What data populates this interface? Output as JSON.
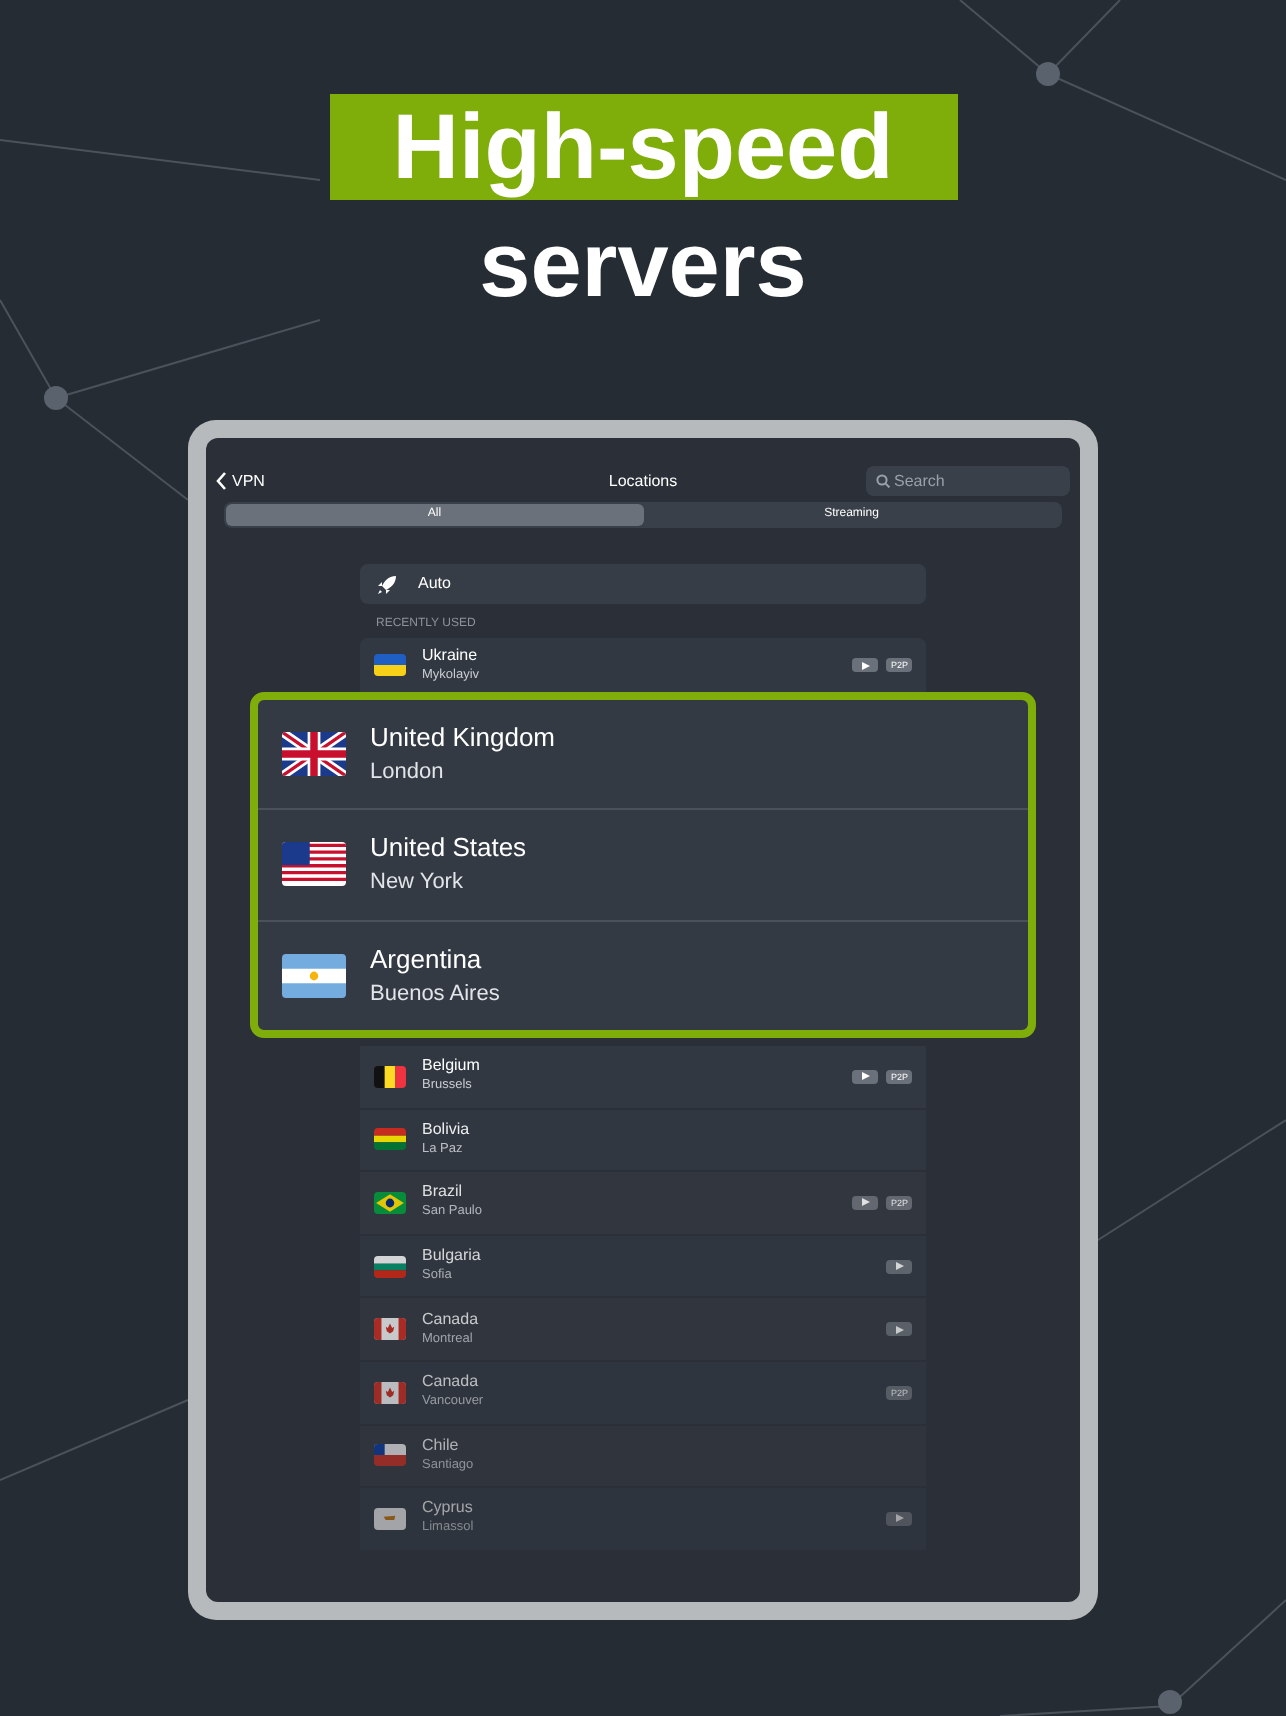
{
  "headline": {
    "highlight": "High-speed",
    "rest": "servers"
  },
  "nav": {
    "back": "VPN",
    "title": "Locations",
    "search": {
      "placeholder": "Search"
    }
  },
  "tabs": [
    {
      "label": "All",
      "selected": true
    },
    {
      "label": "Streaming",
      "selected": false
    }
  ],
  "auto": {
    "label": "Auto"
  },
  "recently_used": {
    "heading": "RECENTLY USED",
    "rows": [
      {
        "country": "Ukraine",
        "city": "Mykolayiv",
        "streaming": true,
        "badges": [
          "P2P"
        ]
      }
    ]
  },
  "featured": [
    {
      "country": "United Kingdom",
      "city": "London"
    },
    {
      "country": "United States",
      "city": "New York"
    },
    {
      "country": "Argentina",
      "city": "Buenos Aires"
    }
  ],
  "locations": [
    {
      "country": "Belgium",
      "city": "Brussels",
      "streaming": true,
      "badges": [
        "P2P"
      ]
    },
    {
      "country": "Bolivia",
      "city": "La Paz",
      "streaming": false
    },
    {
      "country": "Brazil",
      "city": "San Paulo",
      "streaming": true,
      "badges": [
        "P2P"
      ]
    },
    {
      "country": "Bulgaria",
      "city": "Sofia",
      "streaming": true
    },
    {
      "country": "Canada",
      "city": "Montreal",
      "streaming": true
    },
    {
      "country": "Canada",
      "city": "Vancouver",
      "streaming": false,
      "badges": [
        "P2P"
      ]
    },
    {
      "country": "Chile",
      "city": "Santiago",
      "streaming": false
    },
    {
      "country": "Cyprus",
      "city": "Limassol",
      "streaming": true
    }
  ]
}
